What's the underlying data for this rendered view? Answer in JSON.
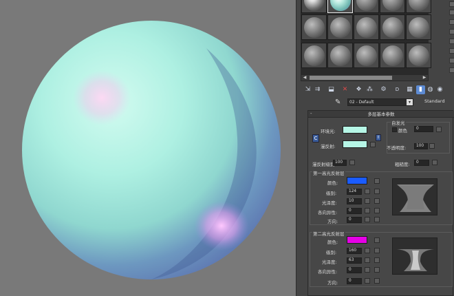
{
  "material": {
    "name": "02 - Default",
    "type_button": "Standard"
  },
  "rollout": {
    "title": "多层基本参数",
    "ambient_label": "环境光:",
    "diffuse_label": "漫反射:",
    "self_illum_group": "自发光",
    "color_label": "颜色",
    "self_illum_value": "0",
    "opacity_label": "不透明度:",
    "opacity_value": "100",
    "diffuse_level_label": "漫反射级别:",
    "diffuse_level_value": "100",
    "roughness_label": "粗糙度:",
    "roughness_value": "0",
    "lock_label": "C",
    "colors": {
      "ambient": "#b6f6e6",
      "diffuse": "#b6f6e6"
    }
  },
  "highlight1": {
    "title": "第一高光反射层",
    "color_label": "颜色:",
    "level_label": "级别:",
    "level_value": "124",
    "gloss_label": "光泽度:",
    "gloss_value": "10",
    "aniso_label": "各向异性:",
    "aniso_value": "0",
    "orient_label": "方向:",
    "orient_value": "0",
    "color": "#1a5cff"
  },
  "highlight2": {
    "title": "第二高光反射层",
    "color_label": "颜色:",
    "level_label": "级别:",
    "level_value": "160",
    "gloss_label": "光泽度:",
    "gloss_value": "63",
    "aniso_label": "各向异性:",
    "aniso_value": "0",
    "orient_label": "方向:",
    "orient_value": "0",
    "color": "#e600e6"
  },
  "toolbar": {
    "icons": [
      "get-material-icon",
      "put-to-scene-icon",
      "assign-icon",
      "reset-icon",
      "copy-icon",
      "unique-icon",
      "library-icon",
      "material-id-icon",
      "show-map-icon",
      "show-end-icon",
      "go-parent-icon",
      "go-sibling-icon"
    ]
  }
}
